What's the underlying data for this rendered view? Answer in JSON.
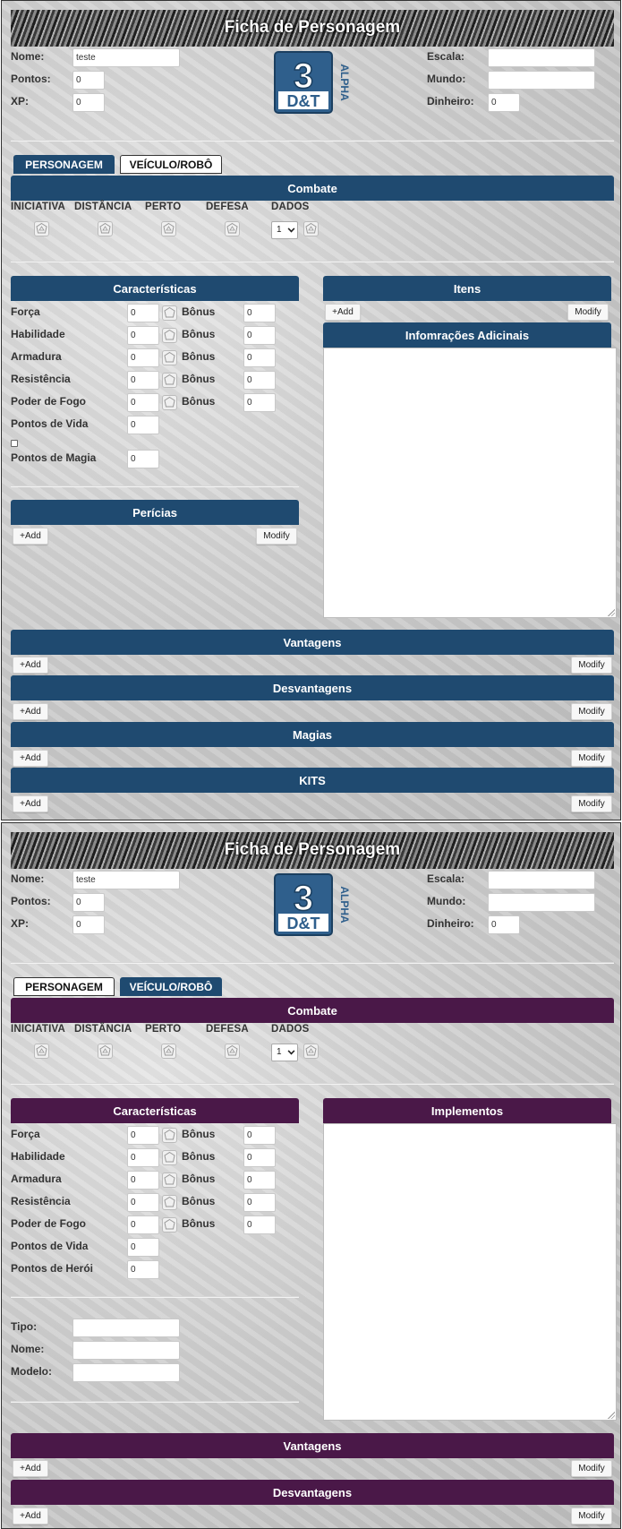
{
  "sheet1": {
    "title": "Ficha de Personagem",
    "header": {
      "nome_label": "Nome:",
      "nome_value": "teste",
      "pontos_label": "Pontos:",
      "pontos_value": "0",
      "xp_label": "XP:",
      "xp_value": "0",
      "escala_label": "Escala:",
      "escala_value": "",
      "mundo_label": "Mundo:",
      "mundo_value": "",
      "dinheiro_label": "Dinheiro:",
      "dinheiro_value": "0"
    },
    "logo": {
      "number": "3",
      "text": "D&T",
      "side": "ALPHA"
    },
    "tabs": {
      "personagem": "PERSONAGEM",
      "veiculo": "VEÍCULO/ROBÔ",
      "active": "personagem"
    },
    "combate": {
      "title": "Combate",
      "cols": [
        "INICIATIVA",
        "DISTÂNCIA",
        "PERTO",
        "DEFESA",
        "DADOS"
      ],
      "dados_value": "1"
    },
    "caracteristicas": {
      "title": "Características",
      "bonus_label": "Bônus",
      "rows": [
        {
          "label": "Força",
          "value": "0",
          "bonus": "0"
        },
        {
          "label": "Habilidade",
          "value": "0",
          "bonus": "0"
        },
        {
          "label": "Armadura",
          "value": "0",
          "bonus": "0"
        },
        {
          "label": "Resistência",
          "value": "0",
          "bonus": "0"
        },
        {
          "label": "Poder de Fogo",
          "value": "0",
          "bonus": "0"
        }
      ],
      "pv_label": "Pontos de Vida",
      "pv_value": "0",
      "pm_label": "Pontos de Magia",
      "pm_value": "0"
    },
    "itens": {
      "title": "Itens",
      "add": "+Add",
      "modify": "Modify"
    },
    "info": {
      "title": "Infomrações Adicinais"
    },
    "pericias": {
      "title": "Perícias",
      "add": "+Add",
      "modify": "Modify"
    },
    "vantagens": {
      "title": "Vantagens",
      "add": "+Add",
      "modify": "Modify"
    },
    "desvantagens": {
      "title": "Desvantagens",
      "add": "+Add",
      "modify": "Modify"
    },
    "magias": {
      "title": "Magias",
      "add": "+Add",
      "modify": "Modify"
    },
    "kits": {
      "title": "KITS",
      "add": "+Add",
      "modify": "Modify"
    }
  },
  "sheet2": {
    "title": "Ficha de Personagem",
    "header": {
      "nome_label": "Nome:",
      "nome_value": "teste",
      "pontos_label": "Pontos:",
      "pontos_value": "0",
      "xp_label": "XP:",
      "xp_value": "0",
      "escala_label": "Escala:",
      "escala_value": "",
      "mundo_label": "Mundo:",
      "mundo_value": "",
      "dinheiro_label": "Dinheiro:",
      "dinheiro_value": "0"
    },
    "logo": {
      "number": "3",
      "text": "D&T",
      "side": "ALPHA"
    },
    "tabs": {
      "personagem": "PERSONAGEM",
      "veiculo": "VEÍCULO/ROBÔ",
      "active": "veiculo"
    },
    "combate": {
      "title": "Combate",
      "cols": [
        "INICIATIVA",
        "DISTÂNCIA",
        "PERTO",
        "DEFESA",
        "DADOS"
      ],
      "dados_value": "1"
    },
    "caracteristicas": {
      "title": "Características",
      "bonus_label": "Bônus",
      "rows": [
        {
          "label": "Força",
          "value": "0",
          "bonus": "0"
        },
        {
          "label": "Habilidade",
          "value": "0",
          "bonus": "0"
        },
        {
          "label": "Armadura",
          "value": "0",
          "bonus": "0"
        },
        {
          "label": "Resistência",
          "value": "0",
          "bonus": "0"
        },
        {
          "label": "Poder de Fogo",
          "value": "0",
          "bonus": "0"
        }
      ],
      "pv_label": "Pontos de Vida",
      "pv_value": "0",
      "ph_label": "Pontos de Herói",
      "ph_value": "0"
    },
    "veiculo": {
      "tipo_label": "Tipo:",
      "tipo_value": "",
      "nome_label": "Nome:",
      "nome_value": "",
      "modelo_label": "Modelo:",
      "modelo_value": ""
    },
    "implementos": {
      "title": "Implementos"
    },
    "vantagens": {
      "title": "Vantagens",
      "add": "+Add",
      "modify": "Modify"
    },
    "desvantagens": {
      "title": "Desvantagens",
      "add": "+Add",
      "modify": "Modify"
    }
  },
  "colors": {
    "blue_bar": "#1f4a70",
    "purple_bar": "#4a1848",
    "logo_blue": "#2f5f8c"
  },
  "icons": {
    "dice": "d20-dice-icon",
    "logo": "3dt-alpha-logo"
  }
}
